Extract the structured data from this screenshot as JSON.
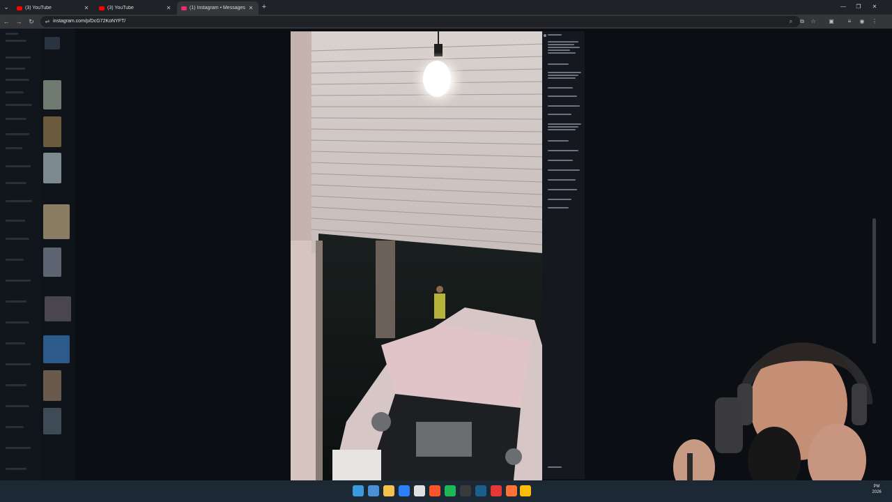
{
  "browser": {
    "tabs": [
      {
        "title": "(3) YouTube",
        "favicon_color": "#ff0000",
        "active": false
      },
      {
        "title": "(3) YouTube",
        "favicon_color": "#ff0000",
        "active": false
      },
      {
        "title": "(1) Instagram • Messages",
        "favicon_color": "#e1306c",
        "active": true
      }
    ],
    "url": "instagram.com/p/DcG72KoNYFT/"
  },
  "icons": {
    "tab_menu": "chevron-down-icon",
    "tab_close": "close-icon",
    "new_tab": "plus-icon",
    "minimize": "minimize-icon",
    "maximize": "maximize-icon",
    "close_window": "close-icon",
    "back": "back-arrow-icon",
    "forward": "forward-arrow-icon",
    "reload": "reload-icon",
    "site_settings": "tune-icon",
    "zoom": "zoom-icon",
    "install": "install-app-icon",
    "bookmark": "star-icon",
    "extensions": "puzzle-icon",
    "media": "media-control-icon",
    "profile": "profile-icon",
    "menu": "kebab-menu-icon"
  },
  "glyphs": {
    "chevron": "⌄",
    "close": "✕",
    "plus": "+",
    "minimize": "—",
    "maximize": "❐",
    "back": "←",
    "forward": "→",
    "reload": "↻",
    "tune": "⇌",
    "zoom": "⌕",
    "install": "⧉",
    "star": "☆",
    "puzzle": "▣",
    "media": "≡",
    "profile": "◉",
    "menu": "⋮"
  },
  "taskbar": {
    "apps": [
      {
        "name": "start-icon",
        "color": "#3a9bdc"
      },
      {
        "name": "task-view-icon",
        "color": "#4c8fd6"
      },
      {
        "name": "file-explorer-icon",
        "color": "#f2c14e"
      },
      {
        "name": "copilot-icon",
        "color": "#2d7ff9"
      },
      {
        "name": "calendar-icon",
        "color": "#e0e0e0"
      },
      {
        "name": "brave-icon",
        "color": "#fb542b"
      },
      {
        "name": "spotify-icon",
        "color": "#1db954"
      },
      {
        "name": "obs-icon",
        "color": "#3a3a3a"
      },
      {
        "name": "steam-icon",
        "color": "#1b5f8c"
      },
      {
        "name": "app-red-icon",
        "color": "#e53935"
      },
      {
        "name": "firefox-icon",
        "color": "#ff7139"
      },
      {
        "name": "chrome-icon",
        "color": "#fbbc05"
      }
    ],
    "time": "PM",
    "year": "2026"
  }
}
